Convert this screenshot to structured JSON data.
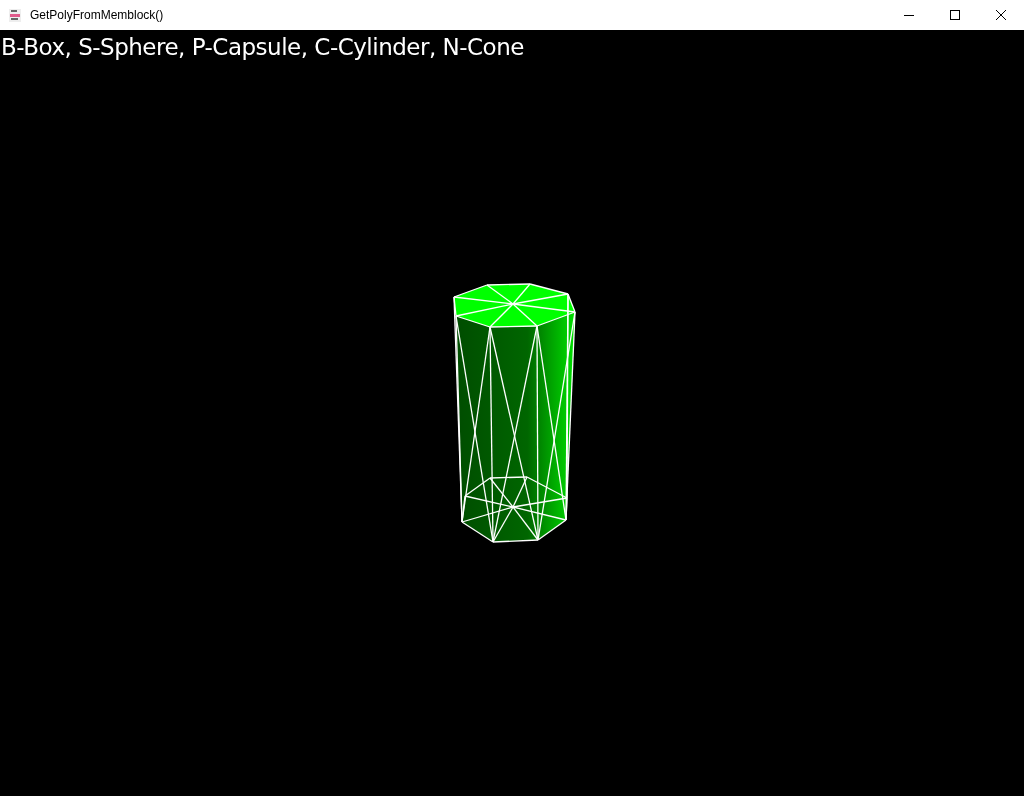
{
  "window": {
    "title": "GetPolyFromMemblock()"
  },
  "overlay_text": "B-Box, S-Sphere, P-Capsule, C-Cylinder, N-Cone"
}
